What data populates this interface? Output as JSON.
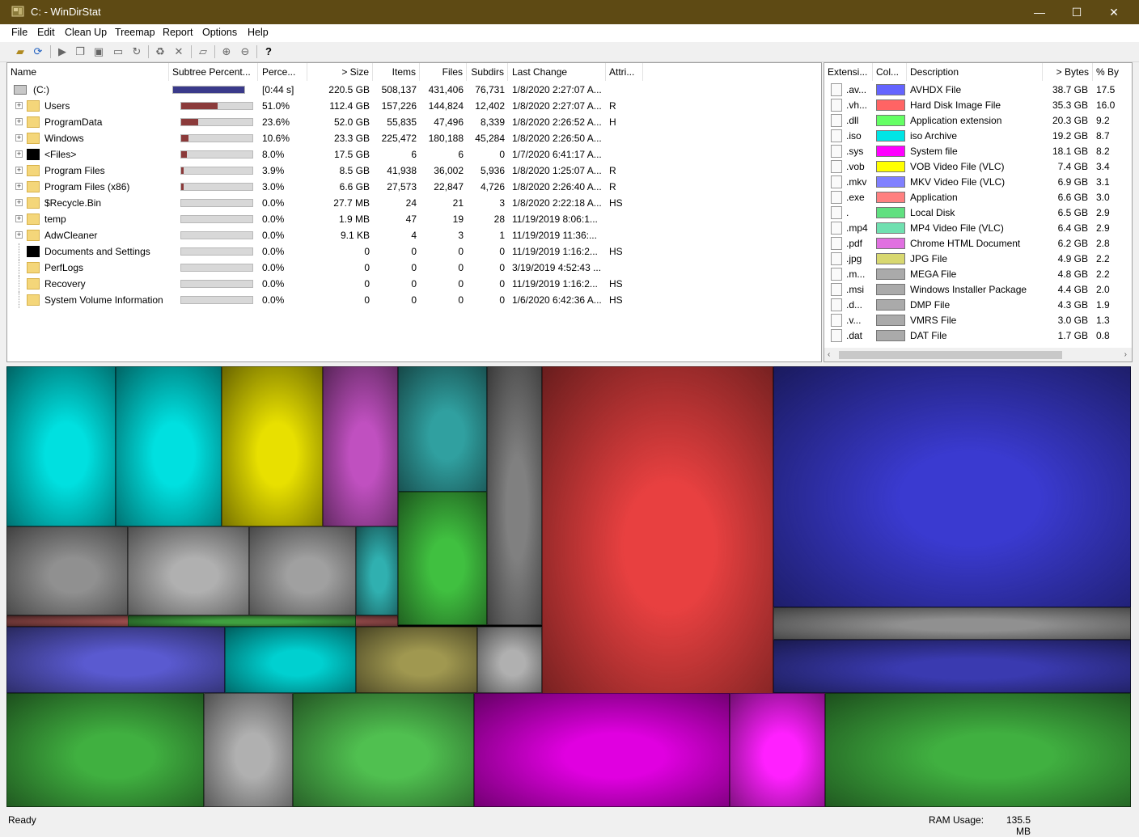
{
  "window": {
    "title": "C: - WinDirStat",
    "minimize": "—",
    "maximize": "☐",
    "close": "✕"
  },
  "menu": [
    "File",
    "Edit",
    "Clean Up",
    "Treemap",
    "Report",
    "Options",
    "Help"
  ],
  "toolbar_icons": [
    "open-folder-icon",
    "refresh-all-icon",
    "play-icon",
    "copy-icon",
    "copy-path-icon",
    "explorer-icon",
    "refresh-icon",
    "delete-recycle-icon",
    "delete-icon",
    "new-folder-icon",
    "zoom-in-icon",
    "zoom-out-icon",
    "help-icon"
  ],
  "dirlist": {
    "headers": [
      "Name",
      "Subtree Percent...",
      "Perce...",
      "> Size",
      "Items",
      "Files",
      "Subdirs",
      "Last Change",
      "Attri..."
    ],
    "rows": [
      {
        "name": "(C:)",
        "pct_label": "[0:44 s]",
        "size": "220.5 GB",
        "items": "508,137",
        "files": "431,406",
        "subdirs": "76,731",
        "last": "1/8/2020  2:27:07 A...",
        "attr": "",
        "fill": 1.0,
        "root": true,
        "icon": "drive",
        "exp": false
      },
      {
        "name": "Users",
        "pct_label": "51.0%",
        "size": "112.4 GB",
        "items": "157,226",
        "files": "144,824",
        "subdirs": "12,402",
        "last": "1/8/2020  2:27:07 A...",
        "attr": "R",
        "fill": 0.51,
        "icon": "folder",
        "exp": true
      },
      {
        "name": "ProgramData",
        "pct_label": "23.6%",
        "size": "52.0 GB",
        "items": "55,835",
        "files": "47,496",
        "subdirs": "8,339",
        "last": "1/8/2020  2:26:52 A...",
        "attr": "H",
        "fill": 0.236,
        "icon": "folder",
        "exp": true
      },
      {
        "name": "Windows",
        "pct_label": "10.6%",
        "size": "23.3 GB",
        "items": "225,472",
        "files": "180,188",
        "subdirs": "45,284",
        "last": "1/8/2020  2:26:50 A...",
        "attr": "",
        "fill": 0.106,
        "icon": "folder",
        "exp": true
      },
      {
        "name": "<Files>",
        "pct_label": "8.0%",
        "size": "17.5 GB",
        "items": "6",
        "files": "6",
        "subdirs": "0",
        "last": "1/7/2020  6:41:17 A...",
        "attr": "",
        "fill": 0.08,
        "icon": "black",
        "exp": true
      },
      {
        "name": "Program Files",
        "pct_label": "3.9%",
        "size": "8.5 GB",
        "items": "41,938",
        "files": "36,002",
        "subdirs": "5,936",
        "last": "1/8/2020  1:25:07 A...",
        "attr": "R",
        "fill": 0.039,
        "icon": "folder",
        "exp": true
      },
      {
        "name": "Program Files (x86)",
        "pct_label": "3.0%",
        "size": "6.6 GB",
        "items": "27,573",
        "files": "22,847",
        "subdirs": "4,726",
        "last": "1/8/2020  2:26:40 A...",
        "attr": "R",
        "fill": 0.03,
        "icon": "folder",
        "exp": true
      },
      {
        "name": "$Recycle.Bin",
        "pct_label": "0.0%",
        "size": "27.7 MB",
        "items": "24",
        "files": "21",
        "subdirs": "3",
        "last": "1/8/2020  2:22:18 A...",
        "attr": "HS",
        "fill": 0,
        "icon": "folder",
        "exp": true
      },
      {
        "name": "temp",
        "pct_label": "0.0%",
        "size": "1.9 MB",
        "items": "47",
        "files": "19",
        "subdirs": "28",
        "last": "11/19/2019  8:06:1...",
        "attr": "",
        "fill": 0,
        "icon": "folder",
        "exp": true
      },
      {
        "name": "AdwCleaner",
        "pct_label": "0.0%",
        "size": "9.1 KB",
        "items": "4",
        "files": "3",
        "subdirs": "1",
        "last": "11/19/2019  11:36:...",
        "attr": "",
        "fill": 0,
        "icon": "folder",
        "exp": true
      },
      {
        "name": "Documents and Settings",
        "pct_label": "0.0%",
        "size": "0",
        "items": "0",
        "files": "0",
        "subdirs": "0",
        "last": "11/19/2019  1:16:2...",
        "attr": "HS",
        "fill": 0,
        "icon": "black",
        "exp": false
      },
      {
        "name": "PerfLogs",
        "pct_label": "0.0%",
        "size": "0",
        "items": "0",
        "files": "0",
        "subdirs": "0",
        "last": "3/19/2019  4:52:43 ...",
        "attr": "",
        "fill": 0,
        "icon": "folder",
        "exp": false
      },
      {
        "name": "Recovery",
        "pct_label": "0.0%",
        "size": "0",
        "items": "0",
        "files": "0",
        "subdirs": "0",
        "last": "11/19/2019  1:16:2...",
        "attr": "HS",
        "fill": 0,
        "icon": "folder",
        "exp": false
      },
      {
        "name": "System Volume Information",
        "pct_label": "0.0%",
        "size": "0",
        "items": "0",
        "files": "0",
        "subdirs": "0",
        "last": "1/6/2020  6:42:36 A...",
        "attr": "HS",
        "fill": 0,
        "icon": "folder",
        "exp": false
      }
    ]
  },
  "extlist": {
    "headers": [
      "Extensi...",
      "Col...",
      "Description",
      "> Bytes",
      "% By"
    ],
    "rows": [
      {
        "ext": ".av...",
        "color": "#6464ff",
        "desc": "AVHDX File",
        "bytes": "38.7 GB",
        "pct": "17.5"
      },
      {
        "ext": ".vh...",
        "color": "#ff6464",
        "desc": "Hard Disk Image File",
        "bytes": "35.3 GB",
        "pct": "16.0"
      },
      {
        "ext": ".dll",
        "color": "#64ff64",
        "desc": "Application extension",
        "bytes": "20.3 GB",
        "pct": "9.2"
      },
      {
        "ext": ".iso",
        "color": "#00e5e5",
        "desc": "iso Archive",
        "bytes": "19.2 GB",
        "pct": "8.7"
      },
      {
        "ext": ".sys",
        "color": "#ff00ff",
        "desc": "System file",
        "bytes": "18.1 GB",
        "pct": "8.2"
      },
      {
        "ext": ".vob",
        "color": "#ffff00",
        "desc": "VOB Video File (VLC)",
        "bytes": "7.4 GB",
        "pct": "3.4"
      },
      {
        "ext": ".mkv",
        "color": "#8080ff",
        "desc": "MKV Video File (VLC)",
        "bytes": "6.9 GB",
        "pct": "3.1"
      },
      {
        "ext": ".exe",
        "color": "#ff8080",
        "desc": "Application",
        "bytes": "6.6 GB",
        "pct": "3.0"
      },
      {
        "ext": ".",
        "color": "#60e080",
        "desc": "Local Disk",
        "bytes": "6.5 GB",
        "pct": "2.9"
      },
      {
        "ext": ".mp4",
        "color": "#70e0b0",
        "desc": "MP4 Video File (VLC)",
        "bytes": "6.4 GB",
        "pct": "2.9"
      },
      {
        "ext": ".pdf",
        "color": "#e070e0",
        "desc": "Chrome HTML Document",
        "bytes": "6.2 GB",
        "pct": "2.8"
      },
      {
        "ext": ".jpg",
        "color": "#d8d870",
        "desc": "JPG File",
        "bytes": "4.9 GB",
        "pct": "2.2"
      },
      {
        "ext": ".m...",
        "color": "#aaaaaa",
        "desc": "MEGA File",
        "bytes": "4.8 GB",
        "pct": "2.2"
      },
      {
        "ext": ".msi",
        "color": "#aaaaaa",
        "desc": "Windows Installer Package",
        "bytes": "4.4 GB",
        "pct": "2.0"
      },
      {
        "ext": ".d...",
        "color": "#aaaaaa",
        "desc": "DMP File",
        "bytes": "4.3 GB",
        "pct": "1.9"
      },
      {
        "ext": ".v...",
        "color": "#aaaaaa",
        "desc": "VMRS File",
        "bytes": "3.0 GB",
        "pct": "1.3"
      },
      {
        "ext": ".dat",
        "color": "#aaaaaa",
        "desc": "DAT File",
        "bytes": "1.7 GB",
        "pct": "0.8"
      }
    ]
  },
  "treemap": {
    "blocks": [
      {
        "color": "#00e0e0"
      },
      {
        "color": "#00e0e0"
      },
      {
        "color": "#e8e000"
      },
      {
        "color": "#c050c0"
      },
      {
        "color": "#30a0a0"
      },
      {
        "color": "#808080"
      },
      {
        "color": "#e84040"
      },
      {
        "color": "#3a3ad0"
      },
      {
        "color": "#909090"
      },
      {
        "color": "#b0b0b0"
      },
      {
        "color": "#a0a0a0"
      },
      {
        "color": "#30b0b0"
      },
      {
        "color": "#40c040"
      },
      {
        "color": "#5a5ad0"
      },
      {
        "color": "#00d0d0"
      },
      {
        "color": "#a09850"
      },
      {
        "color": "#b0b0b0"
      },
      {
        "color": "#40b040"
      },
      {
        "color": "#b0b0b0"
      },
      {
        "color": "#e000e0"
      },
      {
        "color": "#ff20ff"
      },
      {
        "color": "#40b040"
      },
      {
        "color": "#909090"
      },
      {
        "color": "#3a3ab0"
      },
      {
        "color": "#50c050"
      },
      {
        "color": "#a05050"
      },
      {
        "color": "#40a040"
      }
    ]
  },
  "status": {
    "left": "Ready",
    "ram_label": "RAM Usage:",
    "ram_value": "135.5 MB"
  }
}
